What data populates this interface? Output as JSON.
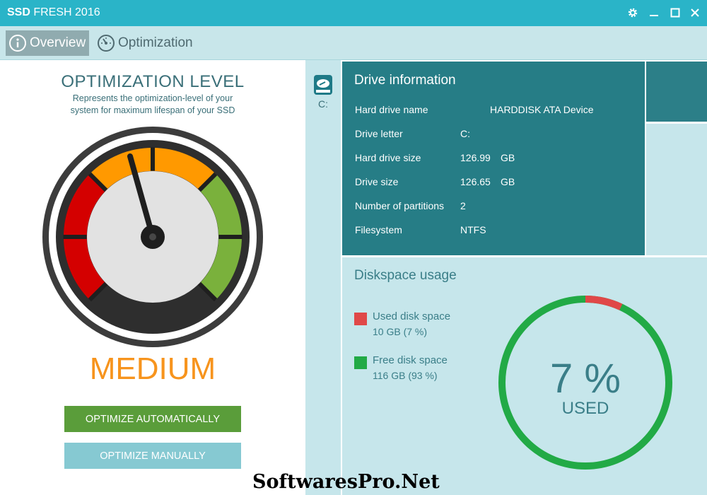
{
  "window": {
    "title_bold": "SSD",
    "title_rest": " FRESH 2016",
    "icons": [
      "gear-icon",
      "minimize-icon",
      "maximize-icon",
      "close-icon"
    ]
  },
  "tabs": [
    {
      "label": "Overview",
      "icon": "info-icon",
      "active": true
    },
    {
      "label": "Optimization",
      "icon": "speedometer-icon",
      "active": false
    }
  ],
  "optimization": {
    "title": "OPTIMIZATION LEVEL",
    "subtitle": "Represents the optimization-level of your system for maximum lifespan of your SSD",
    "level": "MEDIUM",
    "level_color": "#f7941d",
    "auto_button": "OPTIMIZE AUTOMATICALLY",
    "manual_button": "OPTIMIZE MANUALLY"
  },
  "drives": [
    {
      "label": "C:",
      "icon": "hard-drive-icon"
    }
  ],
  "drive_info": {
    "title": "Drive information",
    "rows": [
      {
        "label": "Hard drive name",
        "value": "HARDDISK ATA Device",
        "unit": ""
      },
      {
        "label": "Drive letter",
        "value": "C:",
        "unit": ""
      },
      {
        "label": "Hard drive size",
        "value": "126.99",
        "unit": "GB"
      },
      {
        "label": "Drive size",
        "value": "126.65",
        "unit": "GB"
      },
      {
        "label": "Number of partitions",
        "value": "2",
        "unit": ""
      },
      {
        "label": "Filesystem",
        "value": "NTFS",
        "unit": ""
      }
    ]
  },
  "disk_usage": {
    "title": "Diskspace usage",
    "used_label": "Used disk space",
    "used_value": "10 GB (7 %)",
    "used_color": "#e04848",
    "free_label": "Free disk space",
    "free_value": "116 GB (93 %)",
    "free_color": "#22aa46",
    "used_fraction": 0.07,
    "percent_text": "7 %",
    "used_word": "USED"
  },
  "watermark": "SoftwaresPro.Net"
}
